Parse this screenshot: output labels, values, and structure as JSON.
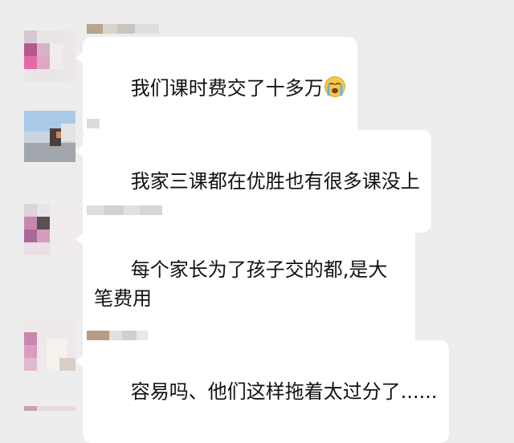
{
  "chat": {
    "messages": [
      {
        "sender": "",
        "text": "我们课时费交了十多万",
        "emoji": "crying-face-icon"
      },
      {
        "sender": "",
        "text": "我家三课都在优胜也有很多课没上",
        "emoji": ""
      },
      {
        "sender": "",
        "text": "每个家长为了孩子交的都,是大笔费用",
        "emoji": ""
      },
      {
        "sender": "",
        "text": "容易吗、他们这样拖着太过分了......",
        "emoji": ""
      }
    ]
  },
  "colors": {
    "background": "#ededed",
    "bubble": "#ffffff",
    "text": "#111111"
  }
}
